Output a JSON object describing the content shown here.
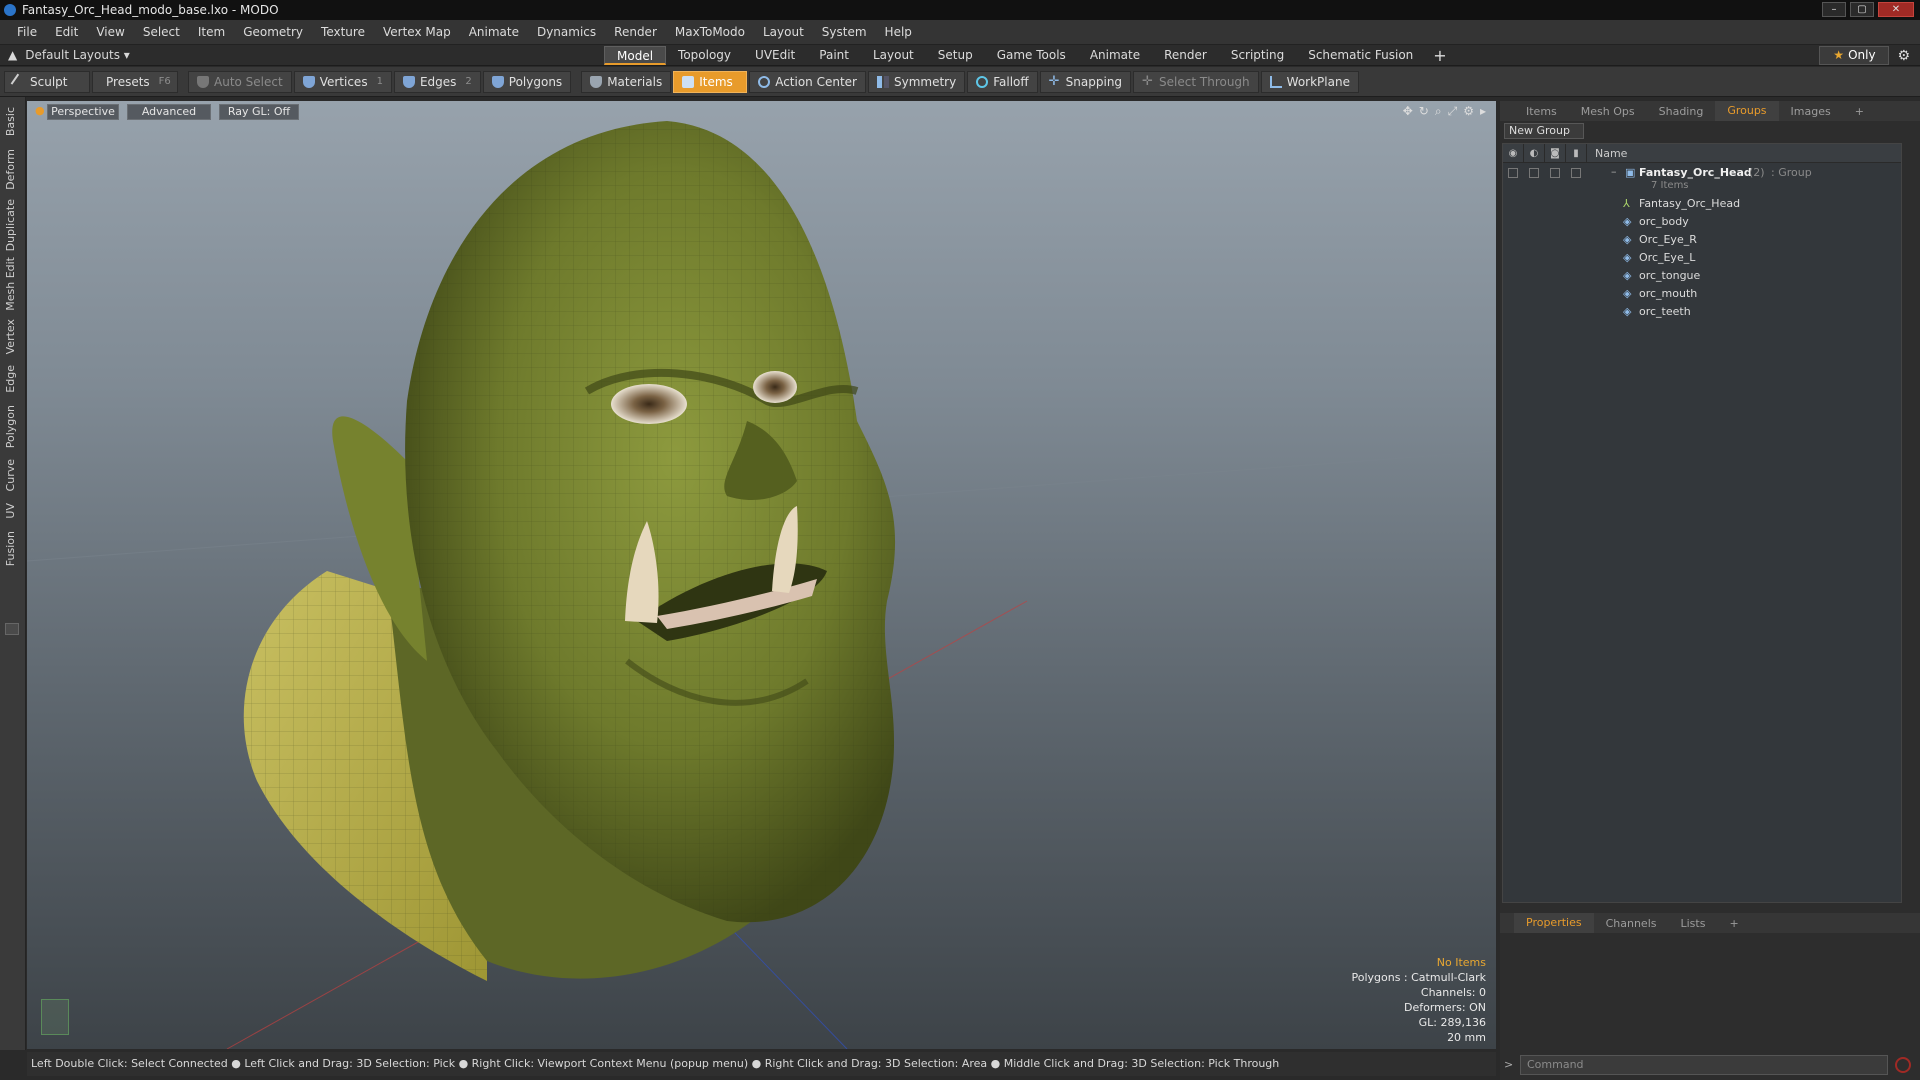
{
  "window": {
    "title": "Fantasy_Orc_Head_modo_base.lxo - MODO"
  },
  "menu": [
    "File",
    "Edit",
    "View",
    "Select",
    "Item",
    "Geometry",
    "Texture",
    "Vertex Map",
    "Animate",
    "Dynamics",
    "Render",
    "MaxToModo",
    "Layout",
    "System",
    "Help"
  ],
  "layout_bar": {
    "layouts_label": "Default Layouts",
    "tabs": [
      "Model",
      "Topology",
      "UVEdit",
      "Paint",
      "Layout",
      "Setup",
      "Game Tools",
      "Animate",
      "Render",
      "Scripting",
      "Schematic Fusion"
    ],
    "active_tab": "Model",
    "only_label": "Only"
  },
  "toolbar": {
    "sculpt": "Sculpt",
    "presets": "Presets",
    "presets_key": "F6",
    "auto_select": "Auto Select",
    "vertices": "Vertices",
    "vertices_count": "1",
    "edges": "Edges",
    "edges_count": "2",
    "polygons": "Polygons",
    "materials": "Materials",
    "items": "Items",
    "action_center": "Action Center",
    "symmetry": "Symmetry",
    "falloff": "Falloff",
    "snapping": "Snapping",
    "select_through": "Select Through",
    "workplane": "WorkPlane"
  },
  "left_tabs": [
    "Basic",
    "Deform",
    "Duplicate",
    "Mesh Edit",
    "Vertex",
    "Edge",
    "Polygon",
    "Curve",
    "UV",
    "Fusion"
  ],
  "viewport": {
    "perspective": "Perspective",
    "advanced": "Advanced",
    "raygl": "Ray GL: Off",
    "stats": {
      "no_items": "No Items",
      "polygons": "Polygons : Catmull-Clark",
      "channels": "Channels: 0",
      "deformers": "Deformers: ON",
      "gl": "GL: 289,136",
      "scale": "20 mm"
    }
  },
  "status_bar": "Left Double Click: Select Connected ● Left Click and Drag: 3D Selection: Pick ● Right Click: Viewport Context Menu (popup menu) ● Right Click and Drag: 3D Selection: Area ● Middle Click and Drag: 3D Selection: Pick Through",
  "right_panel": {
    "tabs": [
      "Items",
      "Mesh Ops",
      "Shading",
      "Groups",
      "Images"
    ],
    "active_tab": "Groups",
    "new_group": "New Group",
    "name_header": "Name",
    "group": {
      "name": "Fantasy_Orc_Head",
      "count": "(2)",
      "type": ": Group",
      "subtitle": "7 Items"
    },
    "items": [
      "Fantasy_Orc_Head",
      "orc_body",
      "Orc_Eye_R",
      "Orc_Eye_L",
      "orc_tongue",
      "orc_mouth",
      "orc_teeth"
    ],
    "bottom_tabs": [
      "Properties",
      "Channels",
      "Lists"
    ],
    "bottom_active": "Properties",
    "command_placeholder": "Command"
  },
  "colors": {
    "accent": "#e89b2b",
    "orc_skin": "#6e7a2c",
    "shoulder": "#b8b04a"
  }
}
